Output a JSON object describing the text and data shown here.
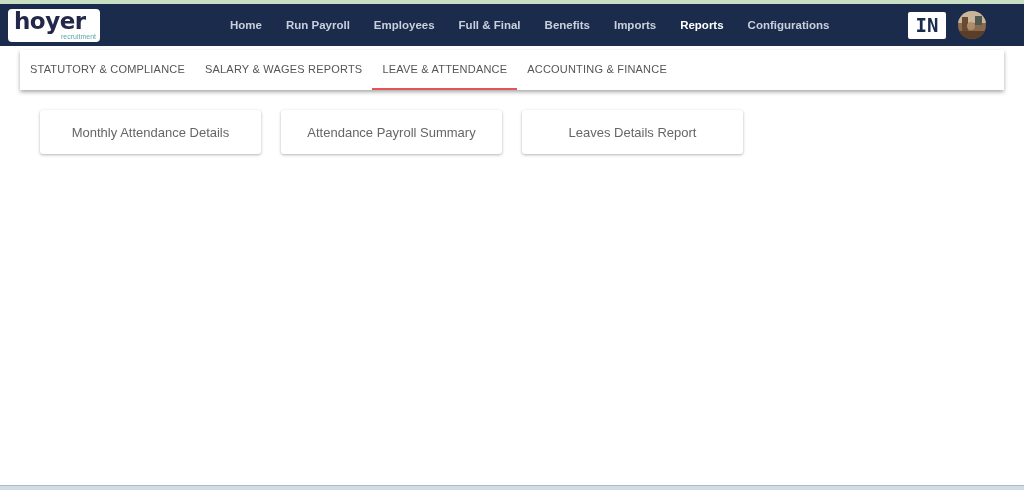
{
  "logo": {
    "text": "hoyer",
    "tagline": "recruitment"
  },
  "nav": [
    {
      "label": "Home",
      "selected": false
    },
    {
      "label": "Run Payroll",
      "selected": false
    },
    {
      "label": "Employees",
      "selected": false
    },
    {
      "label": "Full & Final",
      "selected": false
    },
    {
      "label": "Benefits",
      "selected": false
    },
    {
      "label": "Imports",
      "selected": false
    },
    {
      "label": "Reports",
      "selected": true
    },
    {
      "label": "Configurations",
      "selected": false
    }
  ],
  "language_badge": "IN",
  "avatar": {
    "kind": "picture"
  },
  "tabs": [
    {
      "label": "STATUTORY & COMPLIANCE",
      "selected": false
    },
    {
      "label": "SALARY & WAGES REPORTS",
      "selected": false
    },
    {
      "label": "LEAVE & ATTENDANCE",
      "selected": true
    },
    {
      "label": "ACCOUNTING & FINANCE",
      "selected": false
    }
  ],
  "reports": [
    "Monthly Attendance Details",
    "Attendance Payroll Summary",
    "Leaves Details Report"
  ]
}
